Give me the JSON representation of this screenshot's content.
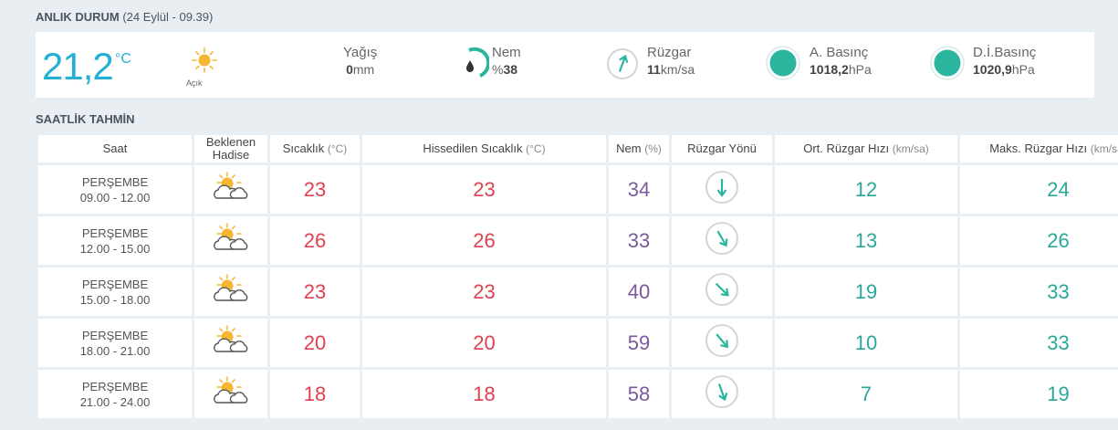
{
  "current": {
    "title": "ANLIK DURUM",
    "subtitle": "(24 Eylül - 09.39)",
    "temperature": "21,2",
    "temp_unit": "°C",
    "condition": "Açık",
    "condition_icon": "sun-icon",
    "rain": {
      "label": "Yağış",
      "value": "0",
      "unit": "mm"
    },
    "humidity": {
      "label": "Nem",
      "prefix": "%",
      "value": "38",
      "icon": "humidity-gauge-icon",
      "accent": "#2ab59e"
    },
    "wind": {
      "label": "Rüzgar",
      "value": "11",
      "unit": "km/sa",
      "icon": "wind-direction-icon"
    },
    "pressure": {
      "label": "A. Basınç",
      "value": "1018,2",
      "unit": "hPa",
      "icon": "pressure-icon"
    },
    "sea_pressure": {
      "label": "D.İ.Basınç",
      "value": "1020,9",
      "unit": "hPa",
      "icon": "pressure-icon"
    },
    "accent_color": "#2ab59e"
  },
  "forecast": {
    "title": "SAATLİK TAHMİN",
    "headers": {
      "time": "Saat",
      "event": "Beklenen Hadise",
      "temp": "Sıcaklık",
      "temp_unit": "(°C)",
      "feel": "Hissedilen Sıcaklık",
      "feel_unit": "(°C)",
      "hum": "Nem",
      "hum_unit": "(%)",
      "wdir": "Rüzgar Yönü",
      "wspd": "Ort. Rüzgar Hızı",
      "wspd_unit": "(km/sa)",
      "wmax": "Maks. Rüzgar Hızı",
      "wmax_unit": "(km/sa)"
    },
    "rows": [
      {
        "day": "PERŞEMBE",
        "range": "09.00 - 12.00",
        "icon": "partly-cloudy-icon",
        "temp": "23",
        "feel": "23",
        "hum": "34",
        "wdir_deg": 180,
        "wspd": "12",
        "wmax": "24"
      },
      {
        "day": "PERŞEMBE",
        "range": "12.00 - 15.00",
        "icon": "partly-cloudy-icon",
        "temp": "26",
        "feel": "26",
        "hum": "33",
        "wdir_deg": 150,
        "wspd": "13",
        "wmax": "26"
      },
      {
        "day": "PERŞEMBE",
        "range": "15.00 - 18.00",
        "icon": "partly-cloudy-icon",
        "temp": "23",
        "feel": "23",
        "hum": "40",
        "wdir_deg": 135,
        "wspd": "19",
        "wmax": "33"
      },
      {
        "day": "PERŞEMBE",
        "range": "18.00 - 21.00",
        "icon": "partly-cloudy-icon",
        "temp": "20",
        "feel": "20",
        "hum": "59",
        "wdir_deg": 140,
        "wspd": "10",
        "wmax": "33"
      },
      {
        "day": "PERŞEMBE",
        "range": "21.00 - 24.00",
        "icon": "partly-cloudy-icon",
        "temp": "18",
        "feel": "18",
        "hum": "58",
        "wdir_deg": 160,
        "wspd": "7",
        "wmax": "19"
      }
    ]
  }
}
